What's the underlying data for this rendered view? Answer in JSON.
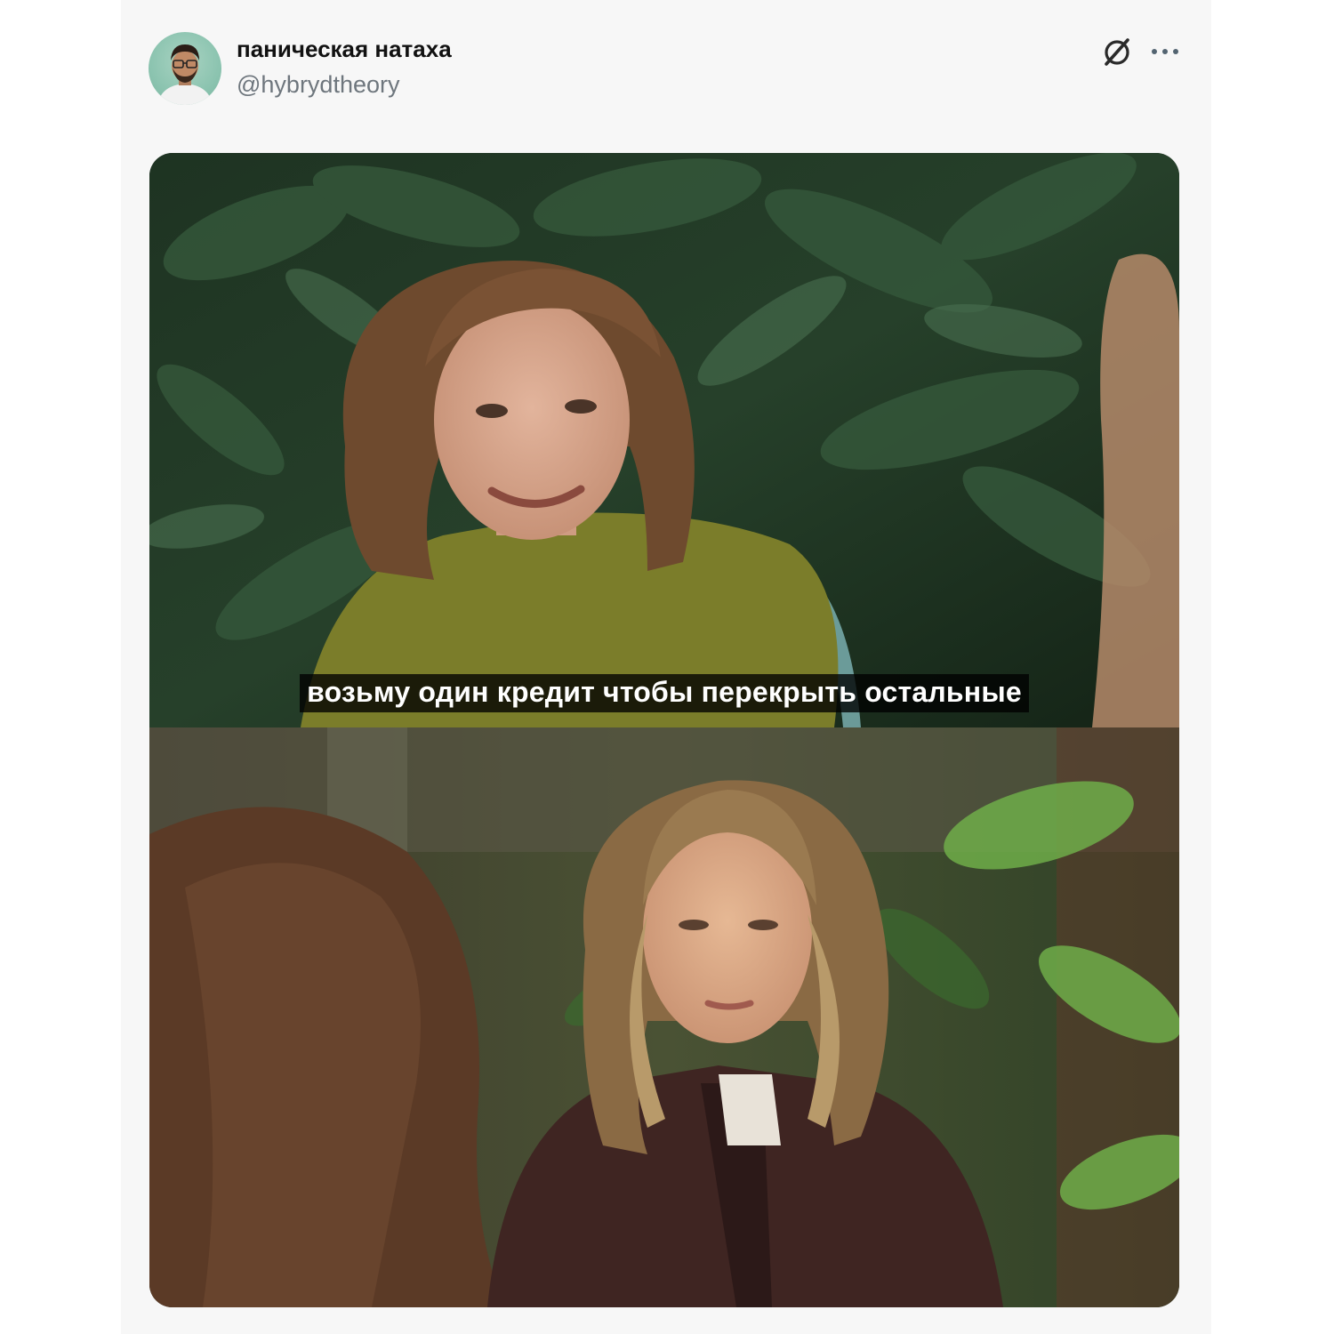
{
  "tweet": {
    "author": {
      "display_name": "паническая натаха",
      "handle": "@hybrydtheory"
    },
    "media": {
      "caption": "возьму один кредит чтобы перекрыть остальные"
    },
    "icons": [
      "grok-icon",
      "more-icon"
    ]
  }
}
